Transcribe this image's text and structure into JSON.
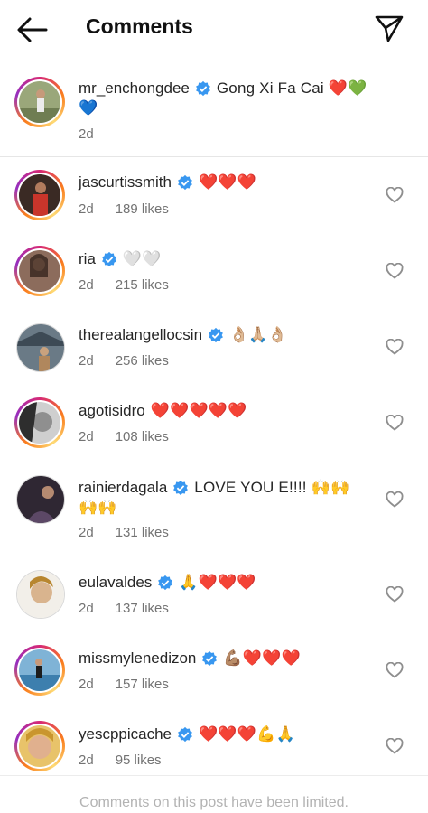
{
  "header": {
    "title": "Comments"
  },
  "caption": {
    "username": "mr_enchongdee",
    "text_line1": "Gong Xi Fa Cai ❤️💚",
    "text_line2": "💙",
    "time": "2d"
  },
  "comments": [
    {
      "username": "jascurtissmith",
      "text": "❤️❤️❤️",
      "time": "2d",
      "likes": "189 likes"
    },
    {
      "username": "ria",
      "text": "🤍🤍",
      "time": "2d",
      "likes": "215 likes"
    },
    {
      "username": "therealangellocsin",
      "text": "👌🏼🙏🏼👌🏼",
      "time": "2d",
      "likes": "256 likes"
    },
    {
      "username": "agotisidro",
      "text": "❤️❤️❤️❤️❤️",
      "time": "2d",
      "likes": "108 likes"
    },
    {
      "username": "rainierdagala",
      "text": "LOVE YOU E!!!! 🙌🙌",
      "text_line2": "🙌🙌",
      "time": "2d",
      "likes": "131 likes"
    },
    {
      "username": "eulavaldes",
      "text": "🙏❤️❤️❤️",
      "time": "2d",
      "likes": "137 likes"
    },
    {
      "username": "missmylenedizon",
      "text": "💪🏽❤️❤️❤️",
      "time": "2d",
      "likes": "157 likes"
    },
    {
      "username": "yescppicache",
      "text": "❤️❤️❤️💪🙏",
      "time": "2d",
      "likes": "95 likes"
    }
  ],
  "footer": {
    "text": "Comments on this post have been limited."
  },
  "colors": {
    "verified": "#3897f0",
    "meta": "#737373",
    "ring_start": "#d62976",
    "ring_end": "#feda75"
  }
}
